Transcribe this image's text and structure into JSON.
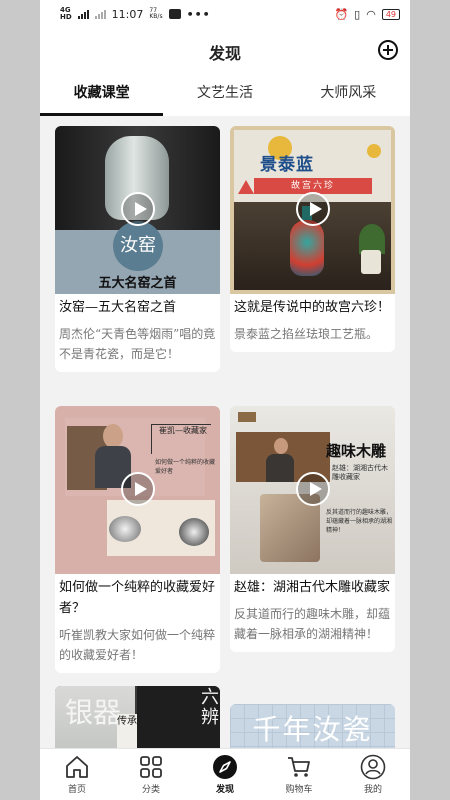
{
  "status_bar": {
    "network_top": "4G",
    "network_sub": "HD",
    "time": "11:07",
    "speed_value": "77",
    "speed_unit": "KB/s",
    "dots": "•••",
    "battery": "49"
  },
  "header": {
    "title": "发现",
    "add_icon": "plus-circle-icon"
  },
  "tabs": [
    {
      "label": "收藏课堂",
      "active": true
    },
    {
      "label": "文艺生活",
      "active": false
    },
    {
      "label": "大师风采",
      "active": false
    }
  ],
  "cards": [
    {
      "title": "汝窑—五大名窑之首",
      "description": "周杰伦“天青色等烟雨”唱的竟不是青花瓷，而是它！",
      "thumb_text": {
        "circle": "汝窑",
        "caption": "五大名窑之首"
      }
    },
    {
      "title": "这就是传说中的故宫六珍！",
      "description": "景泰蓝之掐丝珐琅工艺瓶。",
      "thumb_text": {
        "big": "景泰蓝",
        "sub": "故宫六珍"
      }
    },
    {
      "title": "如何做一个纯粹的收藏爱好者？",
      "description": "听崔凯教大家如何做一个纯粹的收藏爱好者！",
      "thumb_text": {
        "name": "崔凯—收藏家",
        "question": "如何做一个纯粹的收藏爱好者"
      }
    },
    {
      "title": "赵雄：湖湘古代木雕收藏家",
      "description": "反其道而行的趣味木雕，却蕴藏着一脉相承的湖湘精神！",
      "thumb_text": {
        "heading": "趣味木雕",
        "sub": "赵雄：湖湘古代木雕收藏家",
        "desc": "反其道而行的趣味木雕，却蕴藏着一脉相承的湖湘精神！"
      }
    },
    {
      "thumb_text": {
        "left": "银器",
        "mid": "传承",
        "right": "六辨"
      }
    },
    {
      "thumb_text": {
        "heading": "千年汝瓷"
      }
    }
  ],
  "bottom_nav": [
    {
      "label": "首页",
      "icon": "home-icon",
      "active": false
    },
    {
      "label": "分类",
      "icon": "grid-icon",
      "active": false
    },
    {
      "label": "发现",
      "icon": "compass-icon",
      "active": true
    },
    {
      "label": "购物车",
      "icon": "cart-icon",
      "active": false
    },
    {
      "label": "我的",
      "icon": "user-icon",
      "active": false
    }
  ]
}
